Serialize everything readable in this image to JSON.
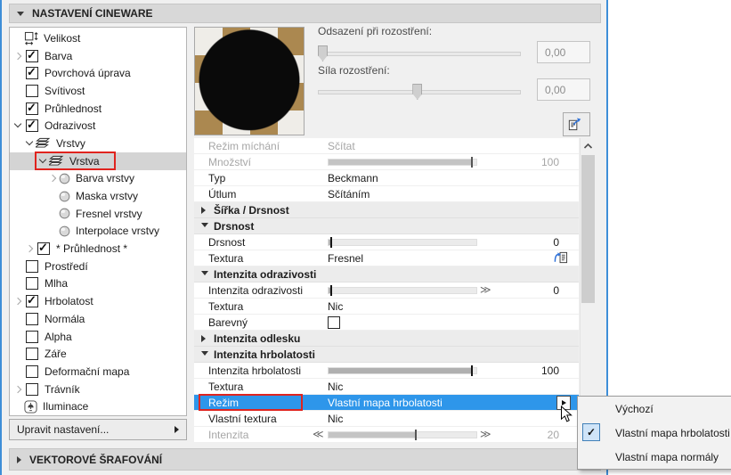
{
  "colors": {
    "accent_blue": "#2e96ea",
    "panel_border_blue": "#3e8ed8",
    "annotation_red": "#e0241f",
    "header_gray": "#d8d8d8",
    "checker_tan": "#ab8850",
    "checker_white": "#efede8",
    "sphere_black": "#0a0a0a"
  },
  "top_header": {
    "title": "NASTAVENÍ CINEWARE",
    "state": "expanded"
  },
  "tree": {
    "items": [
      {
        "label": "Velikost",
        "level": 0,
        "icon": "size"
      },
      {
        "label": "Barva",
        "level": 0,
        "expand": "collapsed",
        "checkbox": true,
        "checked": true
      },
      {
        "label": "Povrchová úprava",
        "level": 0,
        "checkbox": true,
        "checked": true
      },
      {
        "label": "Svítivost",
        "level": 0,
        "checkbox": true,
        "checked": false
      },
      {
        "label": "Průhlednost",
        "level": 0,
        "checkbox": true,
        "checked": true
      },
      {
        "label": "Odrazivost",
        "level": 0,
        "expand": "expanded",
        "checkbox": true,
        "checked": true
      },
      {
        "label": "Vrstvy",
        "level": 1,
        "expand": "expanded",
        "icon": "layers"
      },
      {
        "label": "Vrstva",
        "level": 2,
        "expand": "expanded",
        "icon": "layers",
        "selected": true,
        "annotated": true
      },
      {
        "label": "Barva vrstvy",
        "level": 3,
        "expand": "collapsed",
        "icon": "sphere"
      },
      {
        "label": "Maska vrstvy",
        "level": 3,
        "icon": "sphere"
      },
      {
        "label": "Fresnel vrstvy",
        "level": 3,
        "icon": "sphere"
      },
      {
        "label": "Interpolace vrstvy",
        "level": 3,
        "icon": "sphere"
      },
      {
        "label": "* Průhlednost *",
        "level": 1,
        "expand": "collapsed",
        "checkbox": true,
        "checked": true
      },
      {
        "label": "Prostředí",
        "level": 0,
        "checkbox": true,
        "checked": false
      },
      {
        "label": "Mlha",
        "level": 0,
        "checkbox": true,
        "checked": false
      },
      {
        "label": "Hrbolatost",
        "level": 0,
        "expand": "collapsed",
        "checkbox": true,
        "checked": true
      },
      {
        "label": "Normála",
        "level": 0,
        "checkbox": true,
        "checked": false
      },
      {
        "label": "Alpha",
        "level": 0,
        "checkbox": true,
        "checked": false
      },
      {
        "label": "Záře",
        "level": 0,
        "checkbox": true,
        "checked": false
      },
      {
        "label": "Deformační mapa",
        "level": 0,
        "checkbox": true,
        "checked": false
      },
      {
        "label": "Trávník",
        "level": 0,
        "expand": "collapsed",
        "checkbox": true,
        "checked": false
      },
      {
        "label": "Iluminace",
        "level": 0,
        "icon": "lamp"
      }
    ]
  },
  "edit_button": {
    "label": "Upravit nastavení..."
  },
  "bottom_header": {
    "title": "VEKTOROVÉ ŠRAFOVÁNÍ",
    "state": "collapsed"
  },
  "preview": {
    "description": "black sphere on checkered background"
  },
  "blur_controls": {
    "offset_label": "Odsazení při rozostření:",
    "offset_value": "0,00",
    "offset_slider_pos": 0.0,
    "strength_label": "Síla rozostření:",
    "strength_value": "0,00",
    "strength_slider_pos": 0.49,
    "external_edit_icon": "edit-in-external"
  },
  "table": {
    "rows": [
      {
        "type": "property",
        "label": "Režim míchání",
        "value": "Sčítat",
        "disabled": true
      },
      {
        "type": "property",
        "label": "Množství",
        "slider": 0.97,
        "number": "100",
        "disabled": true
      },
      {
        "type": "property",
        "label": "Typ",
        "value": "Beckmann"
      },
      {
        "type": "property",
        "label": "Útlum",
        "value": "Sčítáním"
      },
      {
        "type": "group",
        "label": "Šířka / Drsnost",
        "state": "collapsed"
      },
      {
        "type": "group",
        "label": "Drsnost",
        "state": "expanded"
      },
      {
        "type": "property",
        "label": "Drsnost",
        "slider": 0.02,
        "number": "0"
      },
      {
        "type": "property",
        "label": "Textura",
        "value": "Fresnel",
        "icon": "assign-texture"
      },
      {
        "type": "group",
        "label": "Intenzita odrazivosti",
        "state": "expanded"
      },
      {
        "type": "property",
        "label": "Intenzita odrazivosti",
        "slider": 0.02,
        "number": "0",
        "marker_right": "≫"
      },
      {
        "type": "property",
        "label": "Textura",
        "value": "Nic"
      },
      {
        "type": "property",
        "label": "Barevný",
        "checkbox": false
      },
      {
        "type": "group",
        "label": "Intenzita odlesku",
        "state": "collapsed"
      },
      {
        "type": "group",
        "label": "Intenzita hrbolatosti",
        "state": "expanded"
      },
      {
        "type": "property",
        "label": "Intenzita hrbolatosti",
        "slider": 0.97,
        "number": "100"
      },
      {
        "type": "property",
        "label": "Textura",
        "value": "Nic"
      },
      {
        "type": "property",
        "label": "Režim",
        "value": "Vlastní mapa hrbolatosti",
        "selected": true,
        "annotated": true,
        "dropdown": true
      },
      {
        "type": "property",
        "label": "Vlastní textura",
        "value": "Nic"
      },
      {
        "type": "property",
        "label": "Intenzita",
        "slider": 0.59,
        "number": "20",
        "disabled": true,
        "marker_left": "≪",
        "marker_right": "≫"
      }
    ]
  },
  "context_menu": {
    "items": [
      {
        "label": "Výchozí",
        "checked": false
      },
      {
        "label": "Vlastní mapa hrbolatosti",
        "checked": true
      },
      {
        "label": "Vlastní mapa normály",
        "checked": false
      }
    ]
  }
}
